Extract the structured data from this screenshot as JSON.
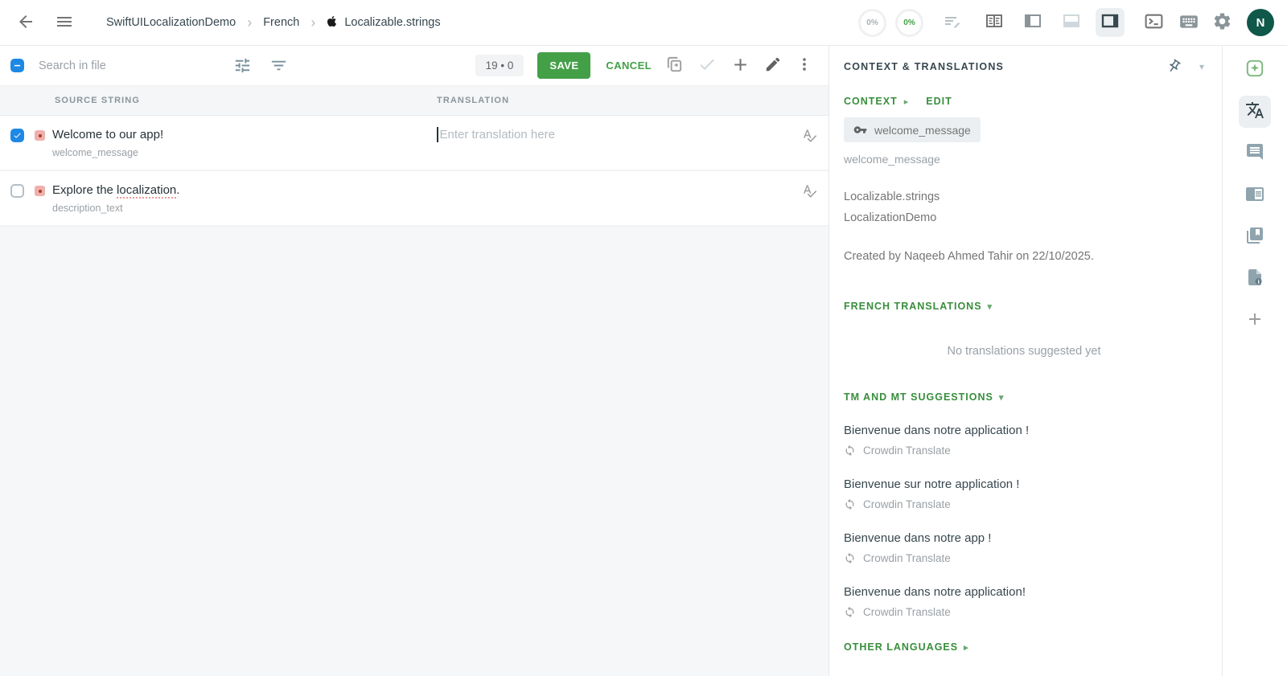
{
  "topbar": {
    "breadcrumb": {
      "project": "SwiftUILocalizationDemo",
      "language": "French",
      "file": "Localizable.strings"
    },
    "progress": {
      "translated": "0%",
      "approved": "0%"
    },
    "avatar_initial": "N"
  },
  "toolbar": {
    "search_placeholder": "Search in file",
    "counter": "19 • 0",
    "save": "SAVE",
    "cancel": "CANCEL"
  },
  "table": {
    "source_header": "SOURCE STRING",
    "translation_header": "TRANSLATION",
    "rows": [
      {
        "source": "Welcome to our app!",
        "key": "welcome_message",
        "placeholder": "Enter translation here"
      },
      {
        "source_prefix": "Explore the ",
        "source_highlight": "localization",
        "source_suffix": ".",
        "key": "description_text"
      }
    ]
  },
  "panel": {
    "title": "CONTEXT & TRANSLATIONS",
    "context_label": "CONTEXT",
    "edit_label": "EDIT",
    "key_chip": "welcome_message",
    "key_name": "welcome_message",
    "file_name": "Localizable.strings",
    "project_name": "LocalizationDemo",
    "created_note": "Created by Naqeeb Ahmed Tahir on 22/10/2025.",
    "french_header": "FRENCH TRANSLATIONS",
    "empty_message": "No translations suggested yet",
    "tm_header": "TM AND MT SUGGESTIONS",
    "other_header": "OTHER LANGUAGES",
    "suggestions": [
      {
        "text": "Bienvenue dans notre application !",
        "source": "Crowdin Translate"
      },
      {
        "text": "Bienvenue sur notre application !",
        "source": "Crowdin Translate"
      },
      {
        "text": "Bienvenue dans notre app !",
        "source": "Crowdin Translate"
      },
      {
        "text": "Bienvenue dans notre application!",
        "source": "Crowdin Translate"
      }
    ]
  },
  "icons": {
    "chevron": "›",
    "caret_down": "▾",
    "caret_right": "▸"
  },
  "colors": {
    "accent_green": "#43a047",
    "section_green": "#388e3c",
    "avatar_green": "#0f584a",
    "checkbox_blue": "#1e88e5",
    "status_red_bg": "#efb0ab",
    "status_red_dot": "#a93b31"
  }
}
